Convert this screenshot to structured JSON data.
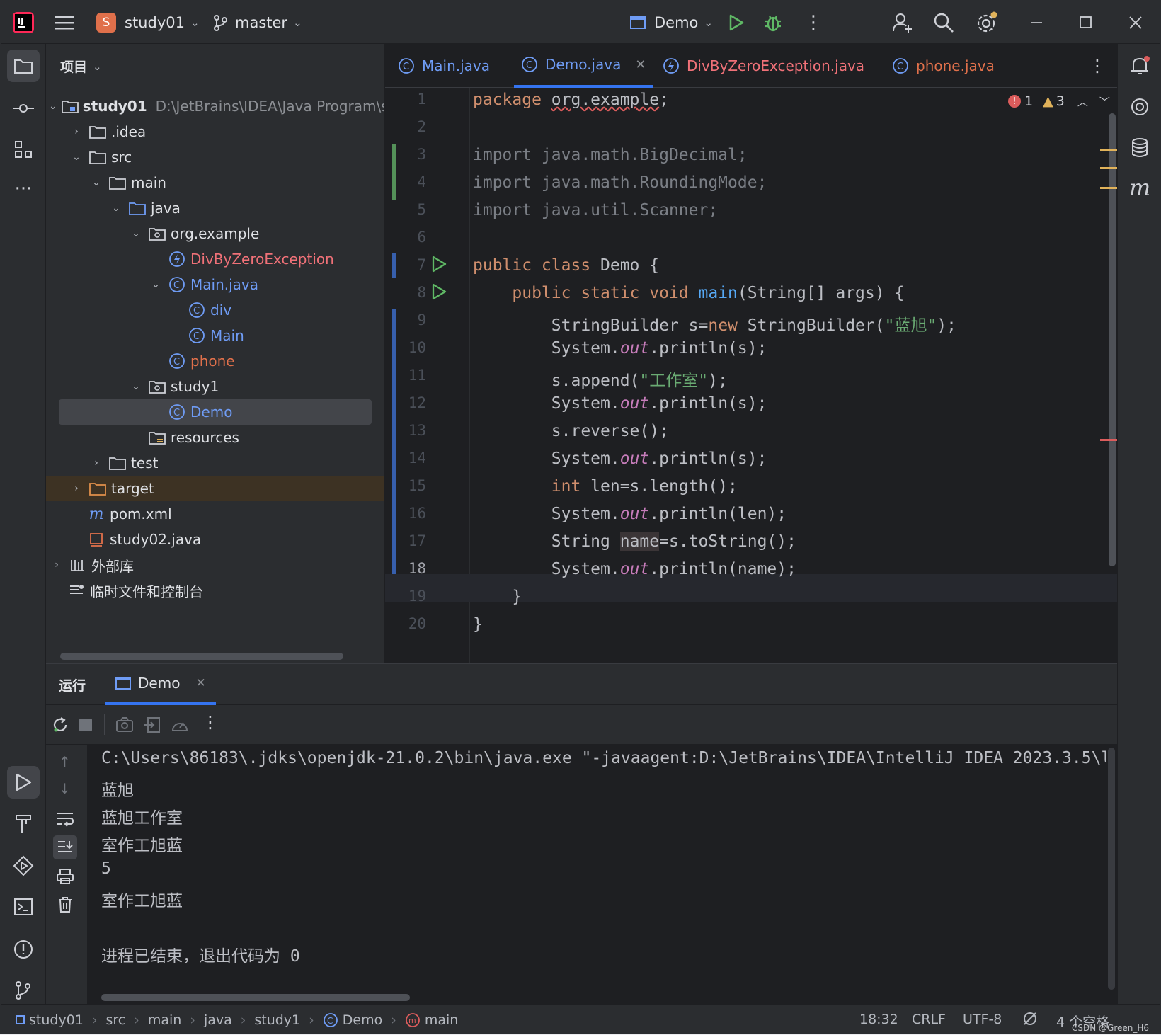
{
  "titlebar": {
    "project_badge": "S",
    "project_name": "study01",
    "branch": "master",
    "run_config": "Demo"
  },
  "project_panel": {
    "header": "项目",
    "tree": [
      {
        "label": "study01",
        "path": "D:\\JetBrains\\IDEA\\Java Program\\stu",
        "icon": "module-folder-icon"
      },
      {
        "label": ".idea",
        "icon": "folder-icon"
      },
      {
        "label": "src",
        "icon": "folder-icon"
      },
      {
        "label": "main",
        "icon": "folder-icon"
      },
      {
        "label": "java",
        "icon": "source-folder-icon"
      },
      {
        "label": "org.example",
        "icon": "package-icon"
      },
      {
        "label": "DivByZeroException",
        "icon": "exception-class-icon"
      },
      {
        "label": "Main.java",
        "icon": "class-icon"
      },
      {
        "label": "div",
        "icon": "class-icon"
      },
      {
        "label": "Main",
        "icon": "class-icon"
      },
      {
        "label": "phone",
        "icon": "class-icon"
      },
      {
        "label": "study1",
        "icon": "package-icon"
      },
      {
        "label": "Demo",
        "icon": "class-icon"
      },
      {
        "label": "resources",
        "icon": "resources-folder-icon"
      },
      {
        "label": "test",
        "icon": "folder-icon"
      },
      {
        "label": "target",
        "icon": "excluded-folder-icon"
      },
      {
        "label": "pom.xml",
        "icon": "maven-icon"
      },
      {
        "label": "study02.java",
        "icon": "java-file-icon"
      },
      {
        "label": "外部库",
        "icon": "library-icon"
      },
      {
        "label": "临时文件和控制台",
        "icon": "scratches-icon"
      }
    ]
  },
  "editor": {
    "tabs": [
      {
        "label": "Main.java"
      },
      {
        "label": "Demo.java"
      },
      {
        "label": "DivByZeroException.java"
      },
      {
        "label": "phone.java"
      }
    ],
    "error_count": "1",
    "warning_count": "3",
    "line_numbers": [
      "1",
      "2",
      "3",
      "4",
      "5",
      "6",
      "7",
      "8",
      "9",
      "10",
      "11",
      "12",
      "13",
      "14",
      "15",
      "16",
      "17",
      "18",
      "19",
      "20"
    ],
    "code": {
      "l1_a": "package ",
      "l1_b": "org.example",
      "l1_c": ";",
      "l3": "import java.math.BigDecimal;",
      "l4": "import java.math.RoundingMode;",
      "l5": "import java.util.Scanner;",
      "l7_a": "public class ",
      "l7_b": "Demo {",
      "l8_a": "    public static void ",
      "l8_b": "main",
      "l8_c": "(String[] args) {",
      "l9_a": "        StringBuilder s=",
      "l9_b": "new ",
      "l9_c": "StringBuilder(",
      "l9_d": "\"蓝旭\"",
      "l9_e": ");",
      "l10_a": "        System.",
      "l10_b": "out",
      "l10_c": ".println(s);",
      "l11_a": "        s.append(",
      "l11_b": "\"工作室\"",
      "l11_c": ");",
      "l12_a": "        System.",
      "l12_b": "out",
      "l12_c": ".println(s);",
      "l13": "        s.reverse();",
      "l14_a": "        System.",
      "l14_b": "out",
      "l14_c": ".println(s);",
      "l15_a": "        ",
      "l15_b": "int ",
      "l15_c": "len=s.length();",
      "l16_a": "        System.",
      "l16_b": "out",
      "l16_c": ".println(len);",
      "l17_a": "        String ",
      "l17_b": "name",
      "l17_c": "=s.toString();",
      "l18_a": "        System.",
      "l18_b": "out",
      "l18_c": ".println(name);",
      "l19": "    }",
      "l20": "}"
    }
  },
  "run_panel": {
    "title": "运行",
    "tab": "Demo",
    "output": [
      "C:\\Users\\86183\\.jdks\\openjdk-21.0.2\\bin\\java.exe \"-javaagent:D:\\JetBrains\\IDEA\\IntelliJ IDEA 2023.3.5\\l",
      "蓝旭",
      "蓝旭工作室",
      "室作工旭蓝",
      "5",
      "室作工旭蓝",
      "",
      "进程已结束，退出代码为 0"
    ]
  },
  "statusbar": {
    "breadcrumbs": [
      "study01",
      "src",
      "main",
      "java",
      "study1",
      "Demo",
      "main"
    ],
    "position": "18:32",
    "line_sep": "CRLF",
    "encoding": "UTF-8",
    "indent": "4 个空格",
    "watermark": "CSDN @Green_H6"
  },
  "colors": {
    "accent": "#3574f0",
    "keyword": "#cf8e6d",
    "string": "#6aab73",
    "method": "#56a8f5",
    "static_field": "#c77dbb",
    "error": "#db5c5c",
    "warning": "#e0b25a",
    "run_green": "#5fb865"
  }
}
